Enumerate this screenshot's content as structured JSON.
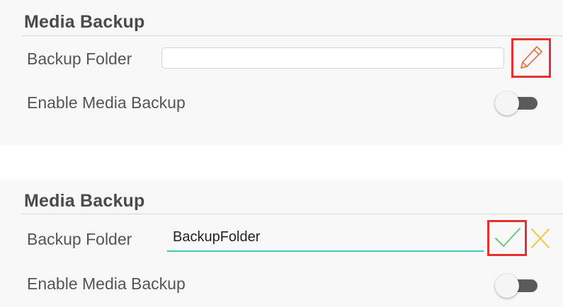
{
  "sections": [
    {
      "title": "Media Backup",
      "backup_folder_label": "Backup Folder",
      "backup_folder_value": "",
      "enable_label": "Enable Media Backup",
      "enable_toggle": "off"
    },
    {
      "title": "Media Backup",
      "backup_folder_label": "Backup Folder",
      "backup_folder_value": "BackupFolder",
      "enable_label": "Enable Media Backup",
      "enable_toggle": "off"
    }
  ],
  "icons": {
    "edit": "pencil-icon",
    "confirm": "check-icon",
    "cancel": "close-icon"
  },
  "colors": {
    "highlight": "#e8302e",
    "pencil": "#e07a4e",
    "confirm": "#6dc97a",
    "cancel": "#f3c233",
    "input_underline": "#3dc8b2",
    "toggle_track": "#5b5b5b"
  }
}
